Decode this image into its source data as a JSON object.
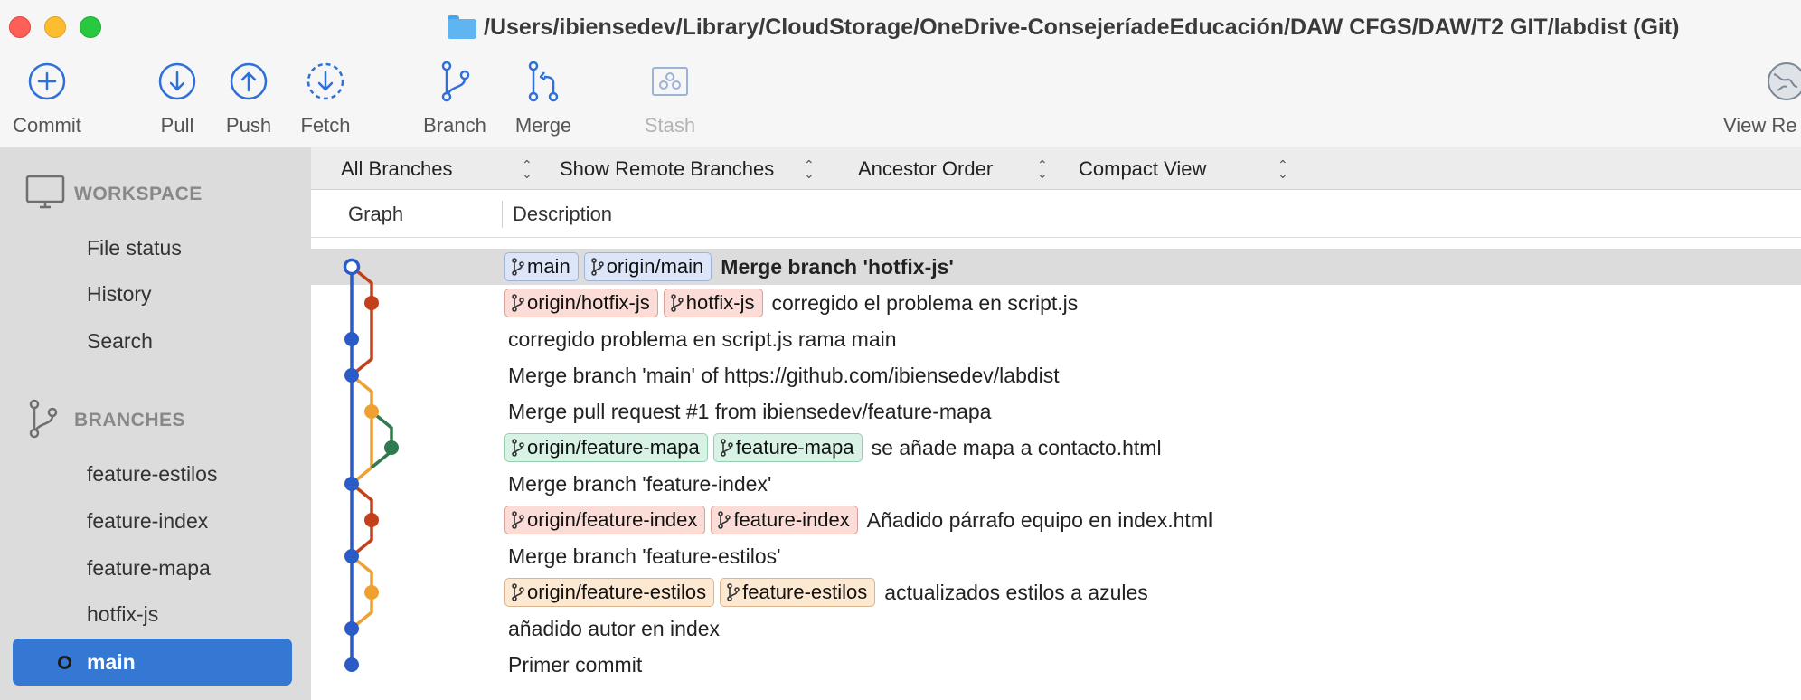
{
  "window": {
    "title": "/Users/ibiensedev/Library/CloudStorage/OneDrive-ConsejeríadeEducación/DAW CFGS/DAW/T2 GIT/labdist (Git)"
  },
  "toolbar": {
    "commit": "Commit",
    "pull": "Pull",
    "push": "Push",
    "fetch": "Fetch",
    "branch": "Branch",
    "merge": "Merge",
    "stash": "Stash",
    "view_remote": "View Re"
  },
  "sidebar": {
    "workspace": {
      "title": "WORKSPACE",
      "items": [
        "File status",
        "History",
        "Search"
      ]
    },
    "branches": {
      "title": "BRANCHES",
      "items": [
        "feature-estilos",
        "feature-index",
        "feature-mapa",
        "hotfix-js",
        "main"
      ],
      "current": "main"
    }
  },
  "filters": {
    "branches": "All Branches",
    "remote": "Show Remote Branches",
    "order": "Ancestor Order",
    "view": "Compact View"
  },
  "columns": {
    "graph": "Graph",
    "description": "Description"
  },
  "colors": {
    "main_lane": "#2a5bc6",
    "hotfix_lane": "#c2411d",
    "feature_lane": "#f0a030",
    "mapa_lane": "#2f7a4f",
    "selection": "#3478d4"
  },
  "commits": [
    {
      "badges": [
        {
          "label": "main",
          "color": "blue"
        },
        {
          "label": "origin/main",
          "color": "blue"
        }
      ],
      "message": "Merge branch 'hotfix-js'"
    },
    {
      "badges": [
        {
          "label": "origin/hotfix-js",
          "color": "red"
        },
        {
          "label": "hotfix-js",
          "color": "red"
        }
      ],
      "message": "corregido el problema en script.js"
    },
    {
      "badges": [],
      "message": "corregido problema en script.js rama main"
    },
    {
      "badges": [],
      "message": "Merge branch 'main' of https://github.com/ibiensedev/labdist"
    },
    {
      "badges": [],
      "message": "Merge pull request #1 from ibiensedev/feature-mapa"
    },
    {
      "badges": [
        {
          "label": "origin/feature-mapa",
          "color": "green"
        },
        {
          "label": "feature-mapa",
          "color": "green"
        }
      ],
      "message": "se añade mapa a contacto.html"
    },
    {
      "badges": [],
      "message": "Merge branch 'feature-index'"
    },
    {
      "badges": [
        {
          "label": "origin/feature-index",
          "color": "red"
        },
        {
          "label": "feature-index",
          "color": "red"
        }
      ],
      "message": "Añadido párrafo equipo en index.html"
    },
    {
      "badges": [],
      "message": "Merge branch 'feature-estilos'"
    },
    {
      "badges": [
        {
          "label": "origin/feature-estilos",
          "color": "orange"
        },
        {
          "label": "feature-estilos",
          "color": "orange"
        }
      ],
      "message": "actualizados estilos a azules"
    },
    {
      "badges": [],
      "message": "añadido autor en index"
    },
    {
      "badges": [],
      "message": "Primer commit"
    }
  ]
}
